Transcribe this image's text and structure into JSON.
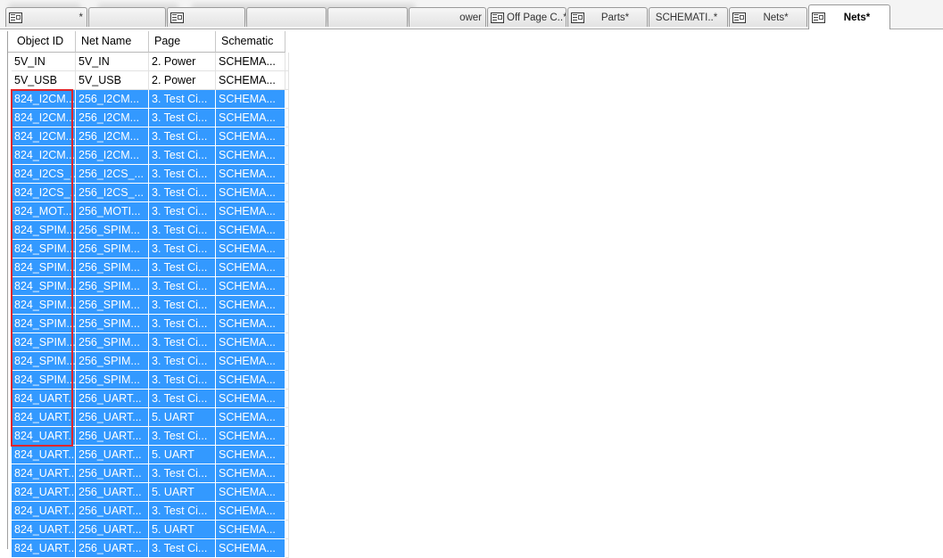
{
  "tabs": [
    {
      "label": "*",
      "active": false
    },
    {
      "label": "",
      "active": false
    },
    {
      "label": "",
      "active": false
    },
    {
      "label": "",
      "active": false
    },
    {
      "label": "",
      "active": false
    },
    {
      "label": "ower",
      "active": false
    },
    {
      "label": "Off Page C..*",
      "active": false
    },
    {
      "label": "Parts*",
      "active": false
    },
    {
      "label": "SCHEMATI..*",
      "active": false
    },
    {
      "label": "Nets*",
      "active": false
    },
    {
      "label": "Nets*",
      "active": true
    }
  ],
  "grid": {
    "columns": [
      "Object ID",
      "Net Name",
      "Page",
      "Schematic"
    ],
    "rows": [
      {
        "selected": false,
        "cells": [
          "5V_IN",
          "5V_IN",
          "2. Power",
          "SCHEMA..."
        ]
      },
      {
        "selected": false,
        "cells": [
          "5V_USB",
          "5V_USB",
          "2. Power",
          "SCHEMA..."
        ]
      },
      {
        "selected": true,
        "cells": [
          "824_I2CM...",
          "256_I2CM...",
          "3. Test Ci...",
          "SCHEMA..."
        ]
      },
      {
        "selected": true,
        "cells": [
          "824_I2CM...",
          "256_I2CM...",
          "3. Test Ci...",
          "SCHEMA..."
        ]
      },
      {
        "selected": true,
        "cells": [
          "824_I2CM...",
          "256_I2CM...",
          "3. Test Ci...",
          "SCHEMA..."
        ]
      },
      {
        "selected": true,
        "cells": [
          "824_I2CM...",
          "256_I2CM...",
          "3. Test Ci...",
          "SCHEMA..."
        ]
      },
      {
        "selected": true,
        "cells": [
          "824_I2CS_...",
          "256_I2CS_...",
          "3. Test Ci...",
          "SCHEMA..."
        ]
      },
      {
        "selected": true,
        "cells": [
          "824_I2CS_...",
          "256_I2CS_...",
          "3. Test Ci...",
          "SCHEMA..."
        ]
      },
      {
        "selected": true,
        "cells": [
          "824_MOT...",
          "256_MOTI...",
          "3. Test Ci...",
          "SCHEMA..."
        ]
      },
      {
        "selected": true,
        "cells": [
          "824_SPIM...",
          "256_SPIM...",
          "3. Test Ci...",
          "SCHEMA..."
        ]
      },
      {
        "selected": true,
        "cells": [
          "824_SPIM...",
          "256_SPIM...",
          "3. Test Ci...",
          "SCHEMA..."
        ]
      },
      {
        "selected": true,
        "cells": [
          "824_SPIM...",
          "256_SPIM...",
          "3. Test Ci...",
          "SCHEMA..."
        ]
      },
      {
        "selected": true,
        "cells": [
          "824_SPIM...",
          "256_SPIM...",
          "3. Test Ci...",
          "SCHEMA..."
        ]
      },
      {
        "selected": true,
        "cells": [
          "824_SPIM...",
          "256_SPIM...",
          "3. Test Ci...",
          "SCHEMA..."
        ]
      },
      {
        "selected": true,
        "cells": [
          "824_SPIM...",
          "256_SPIM...",
          "3. Test Ci...",
          "SCHEMA..."
        ]
      },
      {
        "selected": true,
        "cells": [
          "824_SPIM...",
          "256_SPIM...",
          "3. Test Ci...",
          "SCHEMA..."
        ]
      },
      {
        "selected": true,
        "cells": [
          "824_SPIM...",
          "256_SPIM...",
          "3. Test Ci...",
          "SCHEMA..."
        ]
      },
      {
        "selected": true,
        "cells": [
          "824_SPIM...",
          "256_SPIM...",
          "3. Test Ci...",
          "SCHEMA..."
        ]
      },
      {
        "selected": true,
        "cells": [
          "824_UART...",
          "256_UART...",
          "3. Test Ci...",
          "SCHEMA..."
        ]
      },
      {
        "selected": true,
        "cells": [
          "824_UART...",
          "256_UART...",
          "5. UART",
          "SCHEMA..."
        ]
      },
      {
        "selected": true,
        "cells": [
          "824_UART...",
          "256_UART...",
          "3. Test Ci...",
          "SCHEMA..."
        ]
      },
      {
        "selected": true,
        "cells": [
          "824_UART...",
          "256_UART...",
          "5. UART",
          "SCHEMA..."
        ]
      },
      {
        "selected": true,
        "cells": [
          "824_UART...",
          "256_UART...",
          "3. Test Ci...",
          "SCHEMA..."
        ]
      },
      {
        "selected": true,
        "cells": [
          "824_UART...",
          "256_UART...",
          "5. UART",
          "SCHEMA..."
        ]
      },
      {
        "selected": true,
        "cells": [
          "824_UART...",
          "256_UART...",
          "3. Test Ci...",
          "SCHEMA..."
        ]
      },
      {
        "selected": true,
        "cells": [
          "824_UART...",
          "256_UART...",
          "5. UART",
          "SCHEMA..."
        ]
      },
      {
        "selected": true,
        "cells": [
          "824_UART...",
          "256_UART...",
          "3. Test Ci...",
          "SCHEMA..."
        ]
      }
    ]
  },
  "colors": {
    "selection": "#3399ff",
    "highlight_box": "#e0252b"
  },
  "icons": {
    "tab": "spreadsheet-icon"
  }
}
